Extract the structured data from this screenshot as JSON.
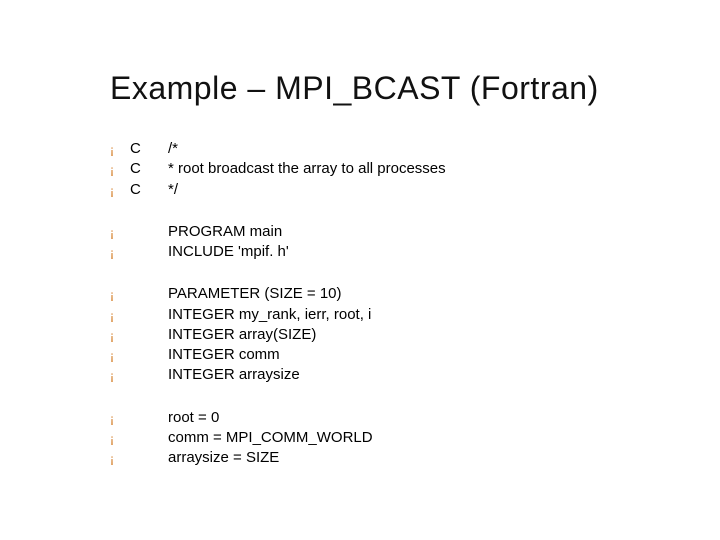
{
  "title": "Example – MPI_BCAST (Fortran)",
  "groups": [
    {
      "lines": [
        {
          "prefix": "C",
          "code": "/*"
        },
        {
          "prefix": "C",
          "code": "* root broadcast the array to all processes"
        },
        {
          "prefix": "C",
          "code": "*/"
        }
      ]
    },
    {
      "lines": [
        {
          "prefix": "",
          "code": "PROGRAM main"
        },
        {
          "prefix": "",
          "code": "INCLUDE 'mpif. h'"
        }
      ]
    },
    {
      "lines": [
        {
          "prefix": "",
          "code": "PARAMETER (SIZE = 10)"
        },
        {
          "prefix": "",
          "code": "INTEGER my_rank, ierr, root, i"
        },
        {
          "prefix": "",
          "code": "INTEGER array(SIZE)"
        },
        {
          "prefix": "",
          "code": "INTEGER comm"
        },
        {
          "prefix": "",
          "code": "INTEGER arraysize"
        }
      ]
    },
    {
      "lines": [
        {
          "prefix": "",
          "code": "root = 0"
        },
        {
          "prefix": "",
          "code": "comm = MPI_COMM_WORLD"
        },
        {
          "prefix": "",
          "code": "arraysize = SIZE"
        }
      ]
    }
  ],
  "bullet_glyph": "¡"
}
